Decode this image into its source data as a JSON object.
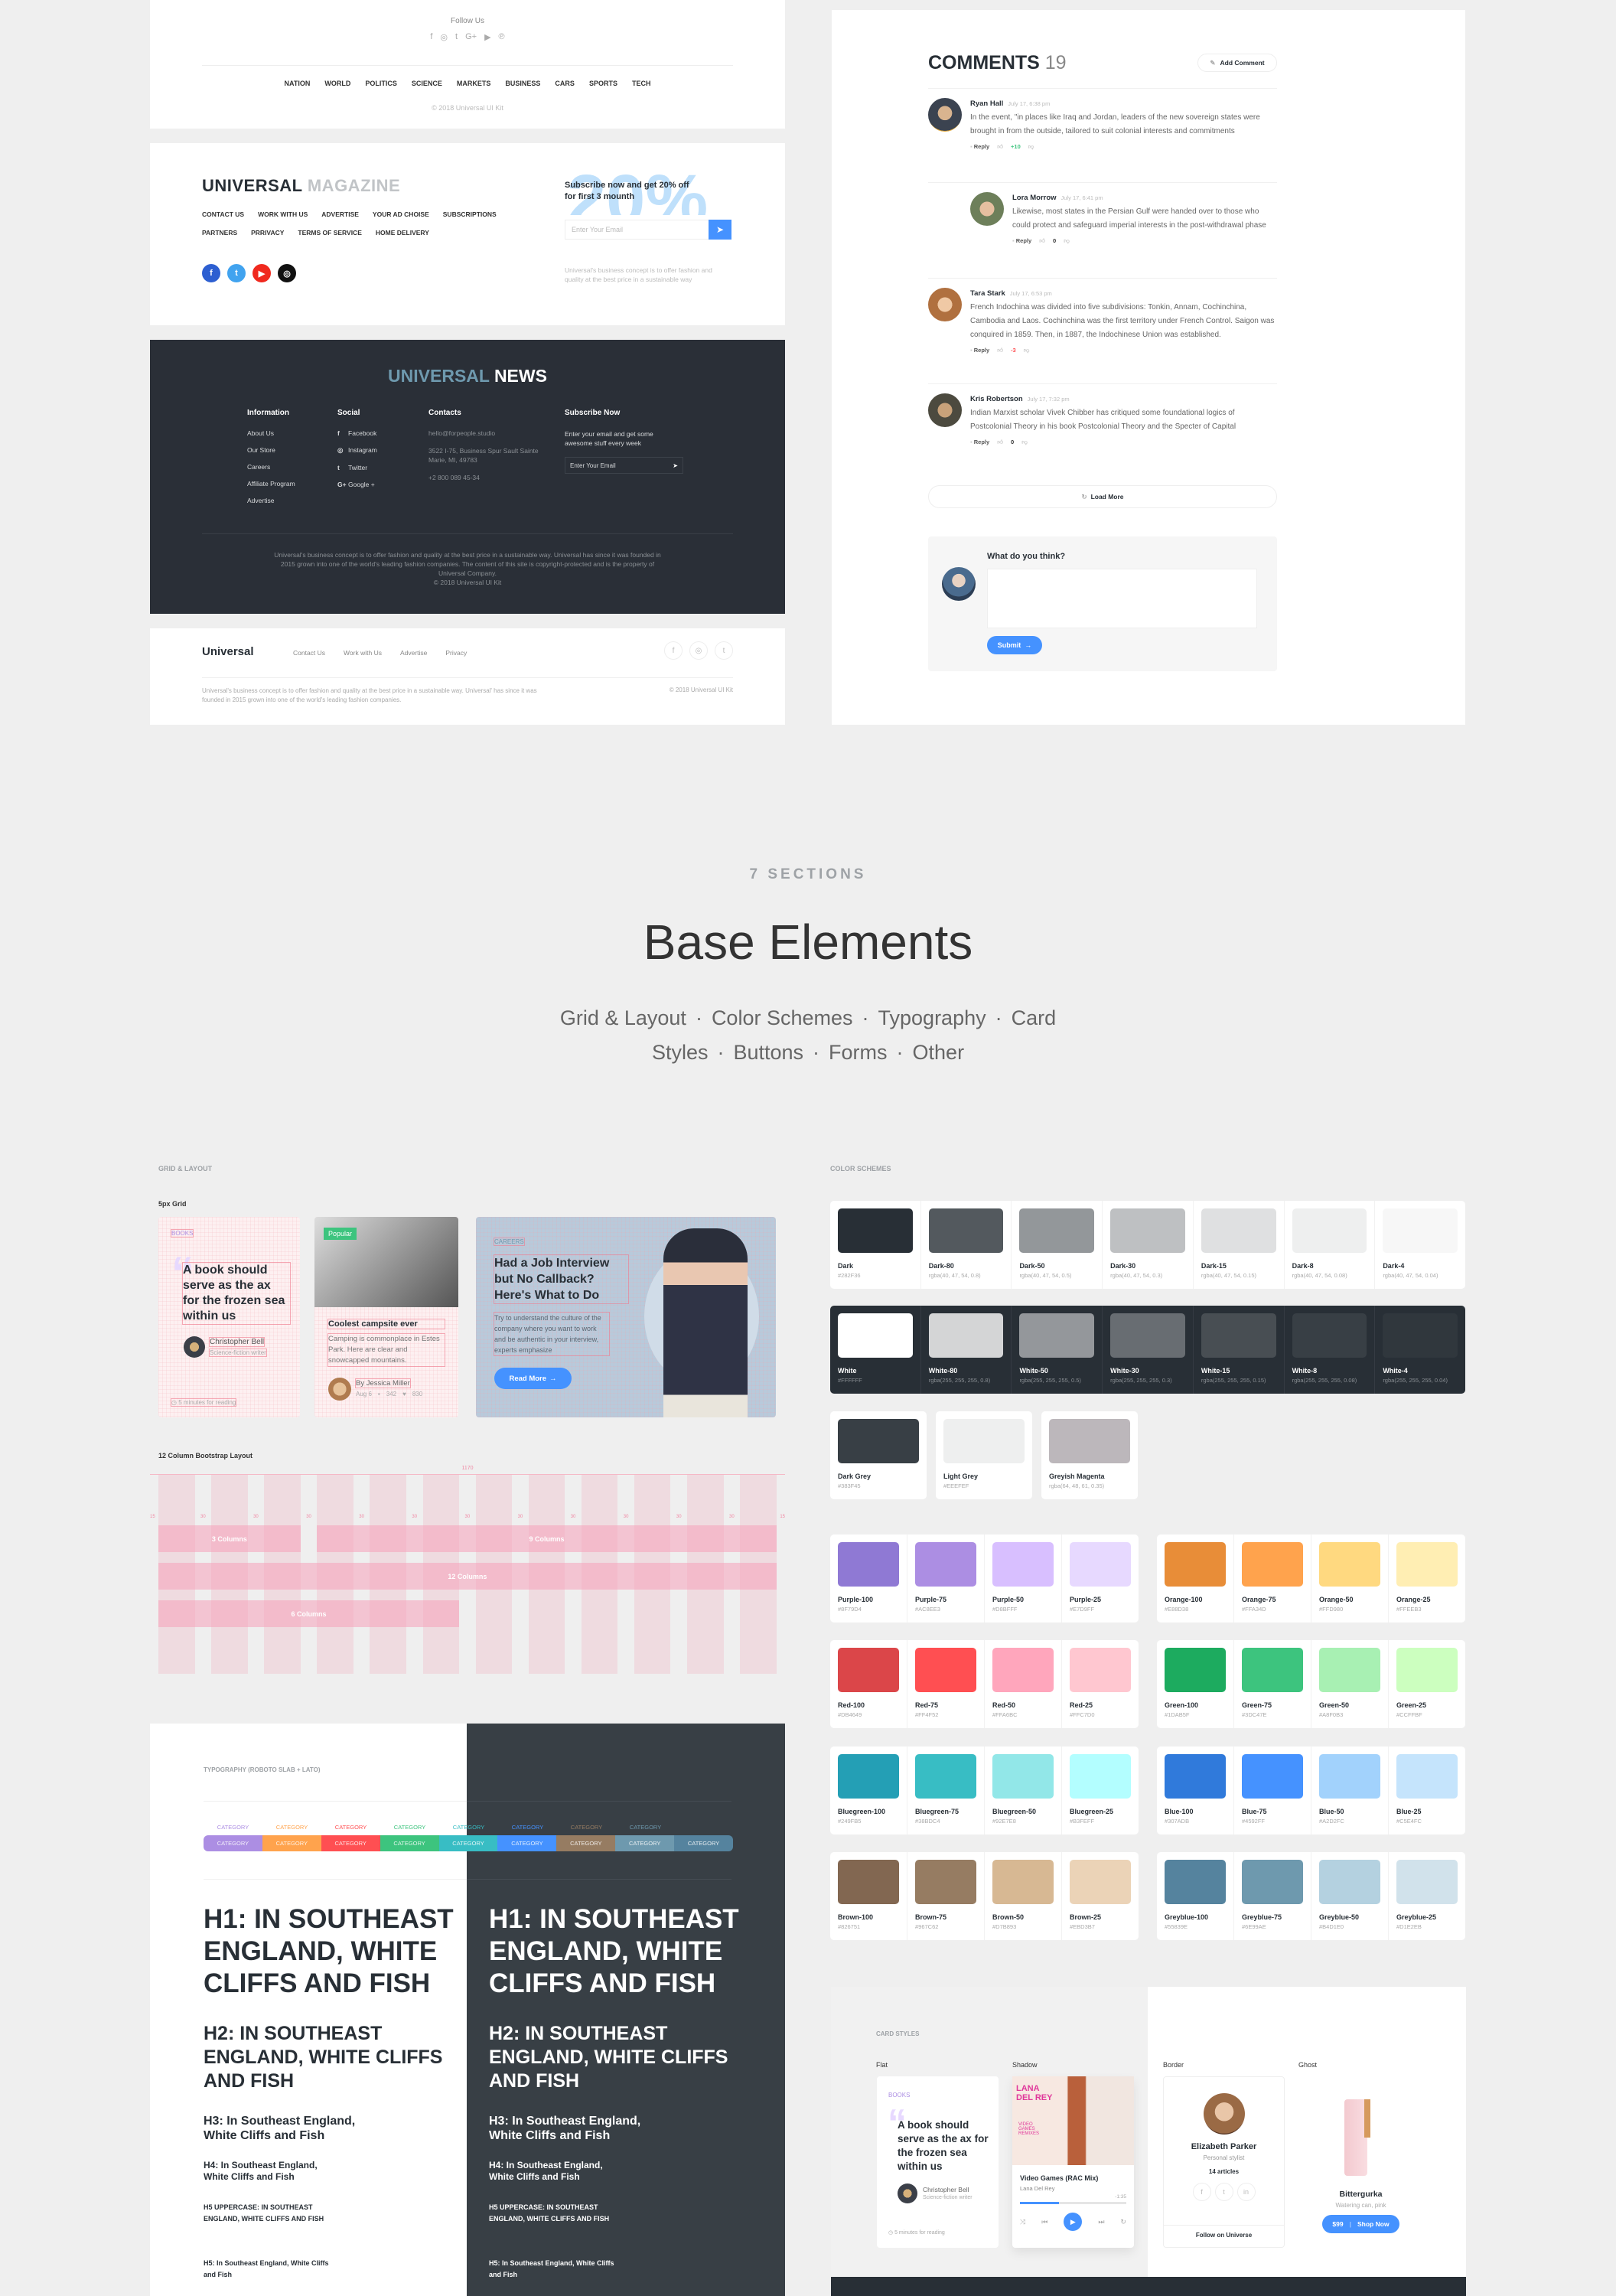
{
  "follow_panel": {
    "title": "Follow Us",
    "icons": [
      "f",
      "◎",
      "t",
      "G+",
      "▶",
      "℗"
    ],
    "icon_names": [
      "facebook-icon",
      "instagram-icon",
      "twitter-icon",
      "google-plus-icon",
      "youtube-icon",
      "pinterest-icon"
    ],
    "nav": [
      "NATION",
      "WORLD",
      "POLITICS",
      "SCIENCE",
      "MARKETS",
      "BUSINESS",
      "CARS",
      "SPORTS",
      "TECH"
    ],
    "copyright": "© 2018 Universal UI Kit"
  },
  "magazine": {
    "logo_main": "UNIVERSAL",
    "logo_accent": "MAGAZINE",
    "links_row1": [
      "CONTACT US",
      "WORK WITH US",
      "ADVERTISE",
      "YOUR AD CHOISE",
      "SUBSCRIPTIONS"
    ],
    "links_row2": [
      "PARTNERS",
      "PRRIVACY",
      "TERMS OF SERVICE",
      "HOME DELIVERY"
    ],
    "social": [
      {
        "icon": "f",
        "name": "facebook-icon",
        "color": "#2d5fd1"
      },
      {
        "icon": "t",
        "name": "twitter-icon",
        "color": "#41a3ef"
      },
      {
        "icon": "▶",
        "name": "youtube-icon",
        "color": "#f0291e"
      },
      {
        "icon": "◎",
        "name": "instagram-icon",
        "color": "#111111"
      }
    ],
    "promo_big": "20%",
    "subscribe_title": "Subscribe now and get 20% off for first 3 mounth",
    "email_placeholder": "Enter Your Email",
    "description": "Universal's business concept is to offer fashion and quality at the best price in a sustainable way"
  },
  "news": {
    "logo_main": "UNIVERSAL",
    "logo_accent": "NEWS",
    "information": {
      "heading": "Information",
      "items": [
        "About Us",
        "Our Store",
        "Careers",
        "Affiliate Program",
        "Advertise"
      ]
    },
    "social": {
      "heading": "Social",
      "items": [
        {
          "icon": "f",
          "label": "Facebook"
        },
        {
          "icon": "◎",
          "label": "Instagram"
        },
        {
          "icon": "t",
          "label": "Twitter"
        },
        {
          "icon": "G+",
          "label": "Google +"
        }
      ]
    },
    "contacts": {
      "heading": "Contacts",
      "email": "hello@forpeople.studio",
      "address": "3522 I-75, Business Spur Sault Sainte Marie, MI, 49783",
      "phone": "+2 800 089 45-34"
    },
    "subscribe": {
      "heading": "Subscribe Now",
      "text": "Enter your email and get some awesome stuff every week",
      "placeholder": "Enter Your Email"
    },
    "fine_print": "Universal's business concept is to offer fashion and quality at the best price in a sustainable way. Universal has since it was founded in 2015 grown into one of the world's leading fashion companies. The content of this site is copyright-protected and is the property of Universal Company.",
    "copyright": "© 2018 Universal UI Kit"
  },
  "bottom_footer": {
    "logo": "Universal",
    "links": [
      "Contact Us",
      "Work with Us",
      "Advertise",
      "Privacy"
    ],
    "social": [
      "f",
      "◎",
      "t"
    ],
    "fine_print": "Universal's business concept is to offer fashion and quality at the best price in a sustainable way. Universal' has since it was founded in 2015 grown into one of the world's leading fashion companies.",
    "copyright": "© 2018 Universal UI Kit"
  },
  "comments": {
    "title": "COMMENTS",
    "count": "19",
    "add_label": "Add Comment",
    "reply_label": "Reply",
    "items": [
      {
        "name": "Ryan Hall",
        "time": "July 17, 6:38 pm",
        "text": "In the event, \"in places like Iraq and Jordan, leaders of the new sovereign states were brought in from the outside, tailored to suit colonial interests and commitments",
        "score": "+10",
        "score_color": "#3dc47e",
        "indent": false
      },
      {
        "name": "Lora Morrow",
        "time": "July 17, 6:41 pm",
        "text": "Likewise, most states in the Persian Gulf were handed over to those who could protect and safeguard imperial interests in the post-withdrawal phase",
        "score": "0",
        "score_color": "#333333",
        "indent": true
      },
      {
        "name": "Tara Stark",
        "time": "July 17, 6:53 pm",
        "text": "French Indochina was divided into five subdivisions: Tonkin, Annam, Cochinchina, Cambodia and Laos. Cochinchina was the first territory under French Control. Saigon was conquired in 1859. Then, in 1887, the Indochinese Union was established.",
        "score": "-3",
        "score_color": "#ff4f52",
        "indent": false
      },
      {
        "name": "Kris Robertson",
        "time": "July 17, 7:32 pm",
        "text": "Indian Marxist scholar Vivek Chibber has critiqued some foundational logics of Postcolonial Theory in his book Postcolonial Theory and the Specter of Capital",
        "score": "0",
        "score_color": "#333333",
        "indent": false
      }
    ],
    "load_more": "Load More",
    "form_title": "What do you think?",
    "submit_label": "Submit"
  },
  "intro": {
    "kicker": "7 SECTIONS",
    "title": "Base Elements",
    "sections": [
      "Grid & Layout",
      "Color Schemes",
      "Typography",
      "Card Styles",
      "Buttons",
      "Forms",
      "Other"
    ]
  },
  "grid_layout": {
    "label": "GRID & LAYOUT",
    "grid5_label": "5px Grid",
    "card1": {
      "category": "BOOKS",
      "quote": "A book should serve as the ax for the frozen sea within us",
      "author": "Christopher Bell",
      "role": "Science-fiction writer",
      "reading": "5 minutes for reading"
    },
    "card2": {
      "badge": "Popular",
      "title": "Coolest campsite ever",
      "text": "Camping is commonplace in Estes Park. Here are clear and snowcapped mountains.",
      "author": "By Jessica Miller",
      "date": "Aug 6",
      "comments": "342",
      "likes": "830"
    },
    "card3": {
      "category": "CAREERS",
      "title": "Had a Job Interview but No Callback? Here's What to Do",
      "text": "Try to understand the culture of the company where you want to work and be authentic in your interview, experts emphasize",
      "button": "Read More"
    },
    "bootstrap_label": "12 Column Bootstrap Layout",
    "container_width": "1170",
    "gutter": "30",
    "margin": "15",
    "bars": [
      {
        "label": "3 Columns",
        "start": 1,
        "span": 3,
        "row": 1
      },
      {
        "label": "9 Columns",
        "start": 4,
        "span": 9,
        "row": 1
      },
      {
        "label": "12 Columns",
        "start": 1,
        "span": 12,
        "row": 2
      },
      {
        "label": "6 Columns",
        "start": 1,
        "span": 6,
        "row": 3
      }
    ]
  },
  "color_schemes": {
    "label": "COLOR SCHEMES",
    "dark": [
      {
        "name": "Dark",
        "value": "#282F36",
        "color": "#282f36"
      },
      {
        "name": "Dark-80",
        "value": "rgba(40, 47, 54, 0.8)",
        "color": "rgba(40,47,54,0.8)"
      },
      {
        "name": "Dark-50",
        "value": "rgba(40, 47, 54, 0.5)",
        "color": "rgba(40,47,54,0.5)"
      },
      {
        "name": "Dark-30",
        "value": "rgba(40, 47, 54, 0.3)",
        "color": "rgba(40,47,54,0.3)"
      },
      {
        "name": "Dark-15",
        "value": "rgba(40, 47, 54, 0.15)",
        "color": "rgba(40,47,54,0.15)"
      },
      {
        "name": "Dark-8",
        "value": "rgba(40, 47, 54, 0.08)",
        "color": "rgba(40,47,54,0.08)"
      },
      {
        "name": "Dark-4",
        "value": "rgba(40, 47, 54, 0.04)",
        "color": "rgba(40,47,54,0.04)"
      }
    ],
    "white": [
      {
        "name": "White",
        "value": "#FFFFFF",
        "color": "#ffffff"
      },
      {
        "name": "White-80",
        "value": "rgba(255, 255, 255, 0.8)",
        "color": "rgba(255,255,255,0.8)"
      },
      {
        "name": "White-50",
        "value": "rgba(255, 255, 255, 0.5)",
        "color": "rgba(255,255,255,0.5)"
      },
      {
        "name": "White-30",
        "value": "rgba(255, 255, 255, 0.3)",
        "color": "rgba(255,255,255,0.3)"
      },
      {
        "name": "White-15",
        "value": "rgba(255, 255, 255, 0.15)",
        "color": "rgba(255,255,255,0.15)"
      },
      {
        "name": "White-8",
        "value": "rgba(255, 255, 255, 0.08)",
        "color": "rgba(255,255,255,0.08)"
      },
      {
        "name": "White-4",
        "value": "rgba(255, 255, 255, 0.04)",
        "color": "rgba(255,255,255,0.04)"
      }
    ],
    "greys": [
      {
        "name": "Dark Grey",
        "value": "#383F45",
        "color": "#383f45"
      },
      {
        "name": "Light Grey",
        "value": "#EEEFEF",
        "color": "#eeefef"
      },
      {
        "name": "Greyish Magenta",
        "value": "rgba(64, 48, 61, 0.35)",
        "color": "rgba(64,48,61,0.35)"
      }
    ],
    "palettes": [
      [
        {
          "name": "Purple-100",
          "value": "#8F79D4"
        },
        {
          "name": "Purple-75",
          "value": "#AC8EE3"
        },
        {
          "name": "Purple-50",
          "value": "#D8BFFF"
        },
        {
          "name": "Purple-25",
          "value": "#E7D9FF"
        }
      ],
      [
        {
          "name": "Orange-100",
          "value": "#E88D38"
        },
        {
          "name": "Orange-75",
          "value": "#FFA34D"
        },
        {
          "name": "Orange-50",
          "value": "#FFD980"
        },
        {
          "name": "Orange-25",
          "value": "#FFEEB3"
        }
      ],
      [
        {
          "name": "Red-100",
          "value": "#DB4649"
        },
        {
          "name": "Red-75",
          "value": "#FF4F52"
        },
        {
          "name": "Red-50",
          "value": "#FFA6BC"
        },
        {
          "name": "Red-25",
          "value": "#FFC7D0"
        }
      ],
      [
        {
          "name": "Green-100",
          "value": "#1DAB5F"
        },
        {
          "name": "Green-75",
          "value": "#3DC47E"
        },
        {
          "name": "Green-50",
          "value": "#A8F0B3"
        },
        {
          "name": "Green-25",
          "value": "#CCFFBF"
        }
      ],
      [
        {
          "name": "Bluegreen-100",
          "value": "#249FB5"
        },
        {
          "name": "Bluegreen-75",
          "value": "#38BDC4"
        },
        {
          "name": "Bluegreen-50",
          "value": "#92E7E8"
        },
        {
          "name": "Bluegreen-25",
          "value": "#B3FEFF"
        }
      ],
      [
        {
          "name": "Blue-100",
          "value": "#307ADB"
        },
        {
          "name": "Blue-75",
          "value": "#4592FF"
        },
        {
          "name": "Blue-50",
          "value": "#A2D2FC"
        },
        {
          "name": "Blue-25",
          "value": "#C5E4FC"
        }
      ],
      [
        {
          "name": "Brown-100",
          "value": "#826751"
        },
        {
          "name": "Brown-75",
          "value": "#967C62"
        },
        {
          "name": "Brown-50",
          "value": "#D7B893"
        },
        {
          "name": "Brown-25",
          "value": "#EBD3B7"
        }
      ],
      [
        {
          "name": "Greyblue-100",
          "value": "#55839E"
        },
        {
          "name": "Greyblue-75",
          "value": "#6E99AE"
        },
        {
          "name": "Greyblue-50",
          "value": "#B4D1E0"
        },
        {
          "name": "Greyblue-25",
          "value": "#D1E2EB"
        }
      ]
    ]
  },
  "typography": {
    "label": "TYPOGRAPHY (ROBOTO SLAB + LATO)",
    "category_label": "CATEGORY",
    "category_colors": [
      "#AC8EE3",
      "#FFA34D",
      "#FF4F52",
      "#3DC47E",
      "#38BDC4",
      "#4592FF",
      "#967C62",
      "#6E99AE",
      "#55839E"
    ],
    "h1": "H1: IN SOUTHEAST ENGLAND, WHITE CLIFFS AND FISH",
    "h2": "H2: IN SOUTHEAST ENGLAND, WHITE CLIFFS AND FISH",
    "h3": "H3: In Southeast England, White Cliffs and Fish",
    "h4": "H4: In Southeast England, White Cliffs and Fish",
    "h5_upper": "H5 UPPERCASE: IN SOUTHEAST ENGLAND, WHITE CLIFFS AND FISH",
    "h5": "H5: In Southeast England, White Cliffs and Fish"
  },
  "card_styles": {
    "label": "CARD STYLES",
    "flat": {
      "label": "Flat",
      "category": "BOOKS",
      "quote": "A book should serve as the ax for the frozen sea within us",
      "author": "Christopher Bell",
      "role": "Science-fiction writer",
      "reading": "5 minutes for reading"
    },
    "shadow": {
      "label": "Shadow",
      "cover_title": "LANA DEL REY",
      "cover_sub": "VIDEO GAMES REMIXES",
      "track": "Video Games (RAC Mix)",
      "artist": "Lana Del Rey",
      "remaining": "-1:35",
      "progress": 0.37
    },
    "border": {
      "label": "Border",
      "name": "Elizabeth Parker",
      "role": "Personal stylist",
      "articles": "14 articles",
      "social": [
        "f",
        "t",
        "in"
      ],
      "follow": "Follow on Universe"
    },
    "ghost": {
      "label": "Ghost",
      "product": "Bittergurka",
      "desc": "Watering can, pink",
      "price": "$99",
      "button": "Shop Now"
    }
  }
}
